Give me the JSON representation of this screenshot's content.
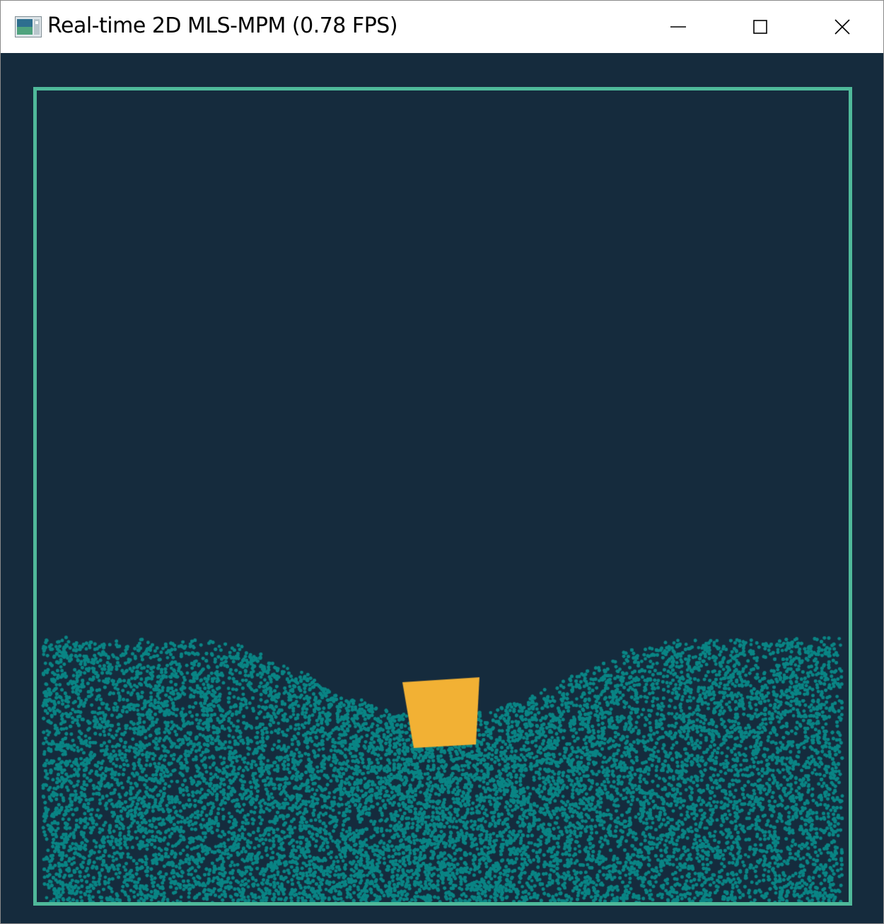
{
  "window": {
    "title": "Real-time 2D MLS-MPM (0.78 FPS)",
    "icon": "app-window-icon",
    "controls": {
      "minimize_icon": "minimize-icon",
      "maximize_icon": "maximize-icon",
      "close_icon": "close-icon"
    }
  },
  "simulation": {
    "background_color": "#152b3d",
    "boundary_color": "#4fb99a",
    "fluid_color": "#0a8585",
    "solid_color": "#f2b134"
  }
}
